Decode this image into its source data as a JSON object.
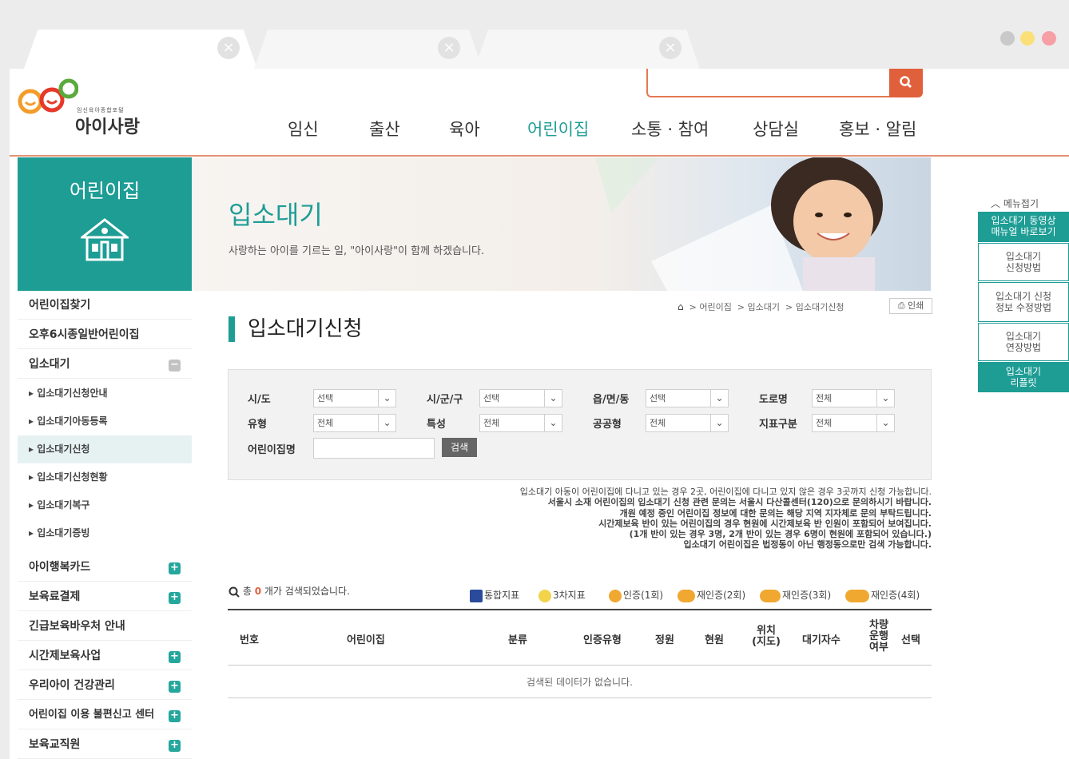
{
  "header": {
    "logo_sub": "임신육아종합포털",
    "logo_main": "아이사랑",
    "nav": [
      "임신",
      "출산",
      "육아",
      "어린이집",
      "소통 · 참여",
      "상담실",
      "홍보 · 알림"
    ]
  },
  "sidebar": {
    "title": "어린이집",
    "items": [
      {
        "label": "어린이집찾기"
      },
      {
        "label": "오후6시종일반어린이집"
      },
      {
        "label": "입소대기"
      },
      {
        "label": "입소대기신청안내"
      },
      {
        "label": "입소대기아동등록"
      },
      {
        "label": "입소대기신청"
      },
      {
        "label": "입소대기신청현황"
      },
      {
        "label": "입소대기복구"
      },
      {
        "label": "입소대기증빙"
      },
      {
        "label": "아이행복카드"
      },
      {
        "label": "보육료결제"
      },
      {
        "label": "긴급보육바우처 안내"
      },
      {
        "label": "시간제보육사업"
      },
      {
        "label": "우리아이 건강관리"
      },
      {
        "label": "어린이집 이용 불편신고 센터"
      },
      {
        "label": "보육교직원"
      }
    ]
  },
  "banner": {
    "title": "입소대기",
    "subtitle": "사랑하는 아이를 기르는 일, \"아이사랑\"이 함께 하겠습니다."
  },
  "breadcrumb": {
    "items": [
      "어린이집",
      "입소대기",
      "입소대기신청"
    ],
    "print": "인쇄"
  },
  "page_title": "입소대기신청",
  "filter": {
    "labels": [
      "시/도",
      "시/군/구",
      "읍/면/동",
      "도로명",
      "유형",
      "특성",
      "공공형",
      "지표구분",
      "어린이집명"
    ],
    "values": [
      "선택",
      "선택",
      "선택",
      "전체",
      "전체",
      "전체",
      "전체",
      "전체"
    ],
    "search_button": "검색"
  },
  "notice": [
    "입소대기 아동이 어린이집에 다니고 있는 경우 2곳, 어린이집에 다니고 있지 않은 경우 3곳까지 신청 가능합니다.",
    "서울시 소재 어린이집의 입소대기 신청 관련 문의는 서울시 다산콜센터(120)으로 문의하시기 바랍니다.",
    "개원 예정 중인 어린이집 정보에 대한 문의는 해당 지역 지자체로 문의 부탁드립니다.",
    "시간제보육 반이 있는 어린이집의 경우 현원에 시간제보육 반 인원이 포함되어 보여집니다.",
    "(1개 반이 있는 경우 3명, 2개 반이 있는 경우 6명이 현원에 포함되어 있습니다.)",
    "입소대기 어린이집은 법정동이 아닌 행정동으로만 검색 가능합니다."
  ],
  "results": {
    "prefix": "총",
    "count": "0",
    "suffix": "개가 검색되었습니다.",
    "legend": [
      "통합지표",
      "3차지표",
      "인증(1회)",
      "재인증(2회)",
      "재인증(3회)",
      "재인증(4회)"
    ]
  },
  "table": {
    "headers": [
      "번호",
      "어린이집",
      "분류",
      "인증유형",
      "정원",
      "현원",
      "위치\n(지도)",
      "대기자수",
      "차량\n운행\n여부",
      "선택"
    ],
    "empty_message": "검색된 데이터가 없습니다."
  },
  "quick_menu": {
    "fold": "메뉴접기",
    "items": [
      "입소대기 동영상\n매뉴얼 바로보기",
      "입소대기\n신청방법",
      "입소대기 신청\n정보 수정방법",
      "입소대기\n연장방법",
      "입소대기\n리플릿"
    ]
  },
  "colors": {
    "brand_green": "#1e9d95",
    "accent_orange": "#e0603c"
  }
}
